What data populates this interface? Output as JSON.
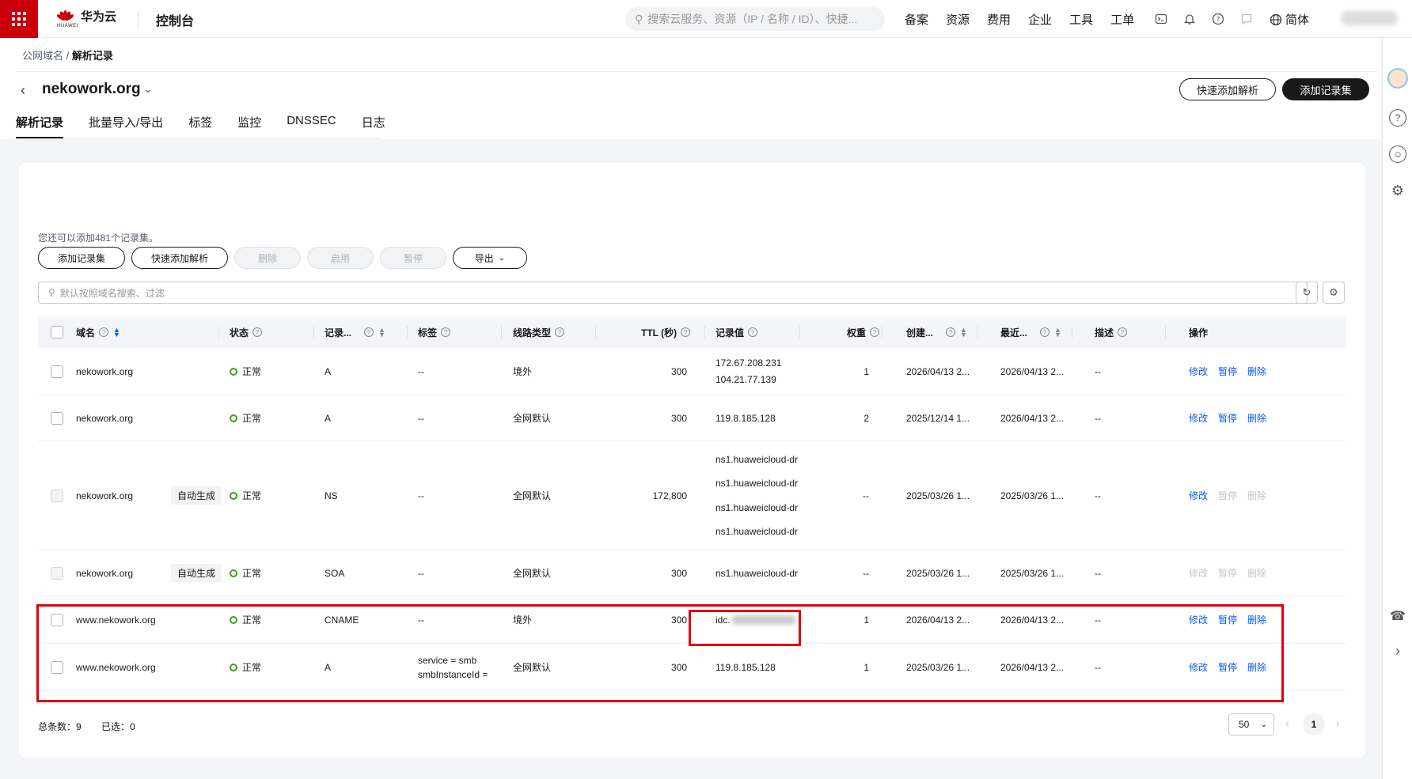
{
  "topbar": {
    "logo_text": "华为云",
    "logo_sub": "HUAWEI",
    "console_title": "控制台",
    "search_placeholder": "搜索云服务、资源（IP / 名称 / ID）、快捷...",
    "nav": [
      "备案",
      "资源",
      "费用",
      "企业",
      "工具",
      "工单"
    ],
    "lang": "简体"
  },
  "breadcrumb": {
    "parent": "公网域名",
    "sep": "/",
    "current": "解析记录"
  },
  "domain": {
    "name": "nekowork.org"
  },
  "header_buttons": {
    "quick_add": "快速添加解析",
    "add_recordset": "添加记录集"
  },
  "tabs": [
    {
      "label": "解析记录",
      "active": true
    },
    {
      "label": "批量导入/导出"
    },
    {
      "label": "标签"
    },
    {
      "label": "监控"
    },
    {
      "label": "DNSSEC"
    },
    {
      "label": "日志"
    }
  ],
  "quota_text": "您还可以添加481个记录集。",
  "toolbar": {
    "add": "添加记录集",
    "quick_add": "快速添加解析",
    "delete": "删除",
    "enable": "启用",
    "pause": "暂停",
    "export": "导出"
  },
  "search": {
    "placeholder": "默认按照域名搜索、过滤"
  },
  "table": {
    "headers": {
      "domain": "域名",
      "status": "状态",
      "type": "记录...",
      "tag": "标签",
      "line": "线路类型",
      "ttl": "TTL (秒)",
      "value": "记录值",
      "weight": "权重",
      "created": "创建...",
      "updated": "最近...",
      "desc": "描述",
      "ops": "操作"
    },
    "rows": [
      {
        "domain": "nekowork.org",
        "auto": "",
        "status": "正常",
        "type": "A",
        "tag1": "--",
        "tag2": "",
        "line": "境外",
        "ttl": "300",
        "values": [
          "172.67.208.231",
          "104.21.77.139"
        ],
        "weight": "1",
        "created": "2026/04/13 2...",
        "updated": "2026/04/13 2...",
        "desc": "--"
      },
      {
        "domain": "nekowork.org",
        "auto": "",
        "status": "正常",
        "type": "A",
        "tag1": "--",
        "tag2": "",
        "line": "全网默认",
        "ttl": "300",
        "values": [
          "119.8.185.128"
        ],
        "weight": "2",
        "created": "2025/12/14 1...",
        "updated": "2026/04/13 2...",
        "desc": "--"
      },
      {
        "domain": "nekowork.org",
        "auto": "自动生成",
        "status": "正常",
        "type": "NS",
        "tag1": "--",
        "tag2": "",
        "line": "全网默认",
        "ttl": "172,800",
        "values": [
          "ns1.huaweicloud-dr",
          "ns1.huaweicloud-dr",
          "ns1.huaweicloud-dr",
          "ns1.huaweicloud-dr"
        ],
        "weight": "--",
        "created": "2025/03/26 1...",
        "updated": "2025/03/26 1...",
        "desc": "--"
      },
      {
        "domain": "nekowork.org",
        "auto": "自动生成",
        "status": "正常",
        "type": "SOA",
        "tag1": "--",
        "tag2": "",
        "line": "全网默认",
        "ttl": "300",
        "values": [
          "ns1.huaweicloud-dr"
        ],
        "weight": "--",
        "created": "2025/03/26 1...",
        "updated": "2025/03/26 1...",
        "desc": "--"
      },
      {
        "domain": "www.nekowork.org",
        "auto": "",
        "status": "正常",
        "type": "CNAME",
        "tag1": "--",
        "tag2": "",
        "line": "境外",
        "ttl": "300",
        "values": [
          "idc."
        ],
        "weight": "1",
        "created": "2026/04/13 2...",
        "updated": "2026/04/13 2...",
        "desc": "--"
      },
      {
        "domain": "www.nekowork.org",
        "auto": "",
        "status": "正常",
        "type": "A",
        "tag1": "service = smb",
        "tag2": "smbInstanceId =",
        "line": "全网默认",
        "ttl": "300",
        "values": [
          "119.8.185.128"
        ],
        "weight": "1",
        "created": "2025/03/26 1...",
        "updated": "2026/04/13 2...",
        "desc": "--"
      }
    ],
    "ops": {
      "edit": "修改",
      "pause": "暂停",
      "delete": "删除"
    }
  },
  "footer": {
    "total": "总条数：9",
    "selected": "已选：0",
    "page_size": "50",
    "current_page": "1"
  },
  "colors": {
    "brand": "#c7000b",
    "link": "#0a59f7",
    "ok": "#3aa01f",
    "highlight": "#e0000f"
  }
}
